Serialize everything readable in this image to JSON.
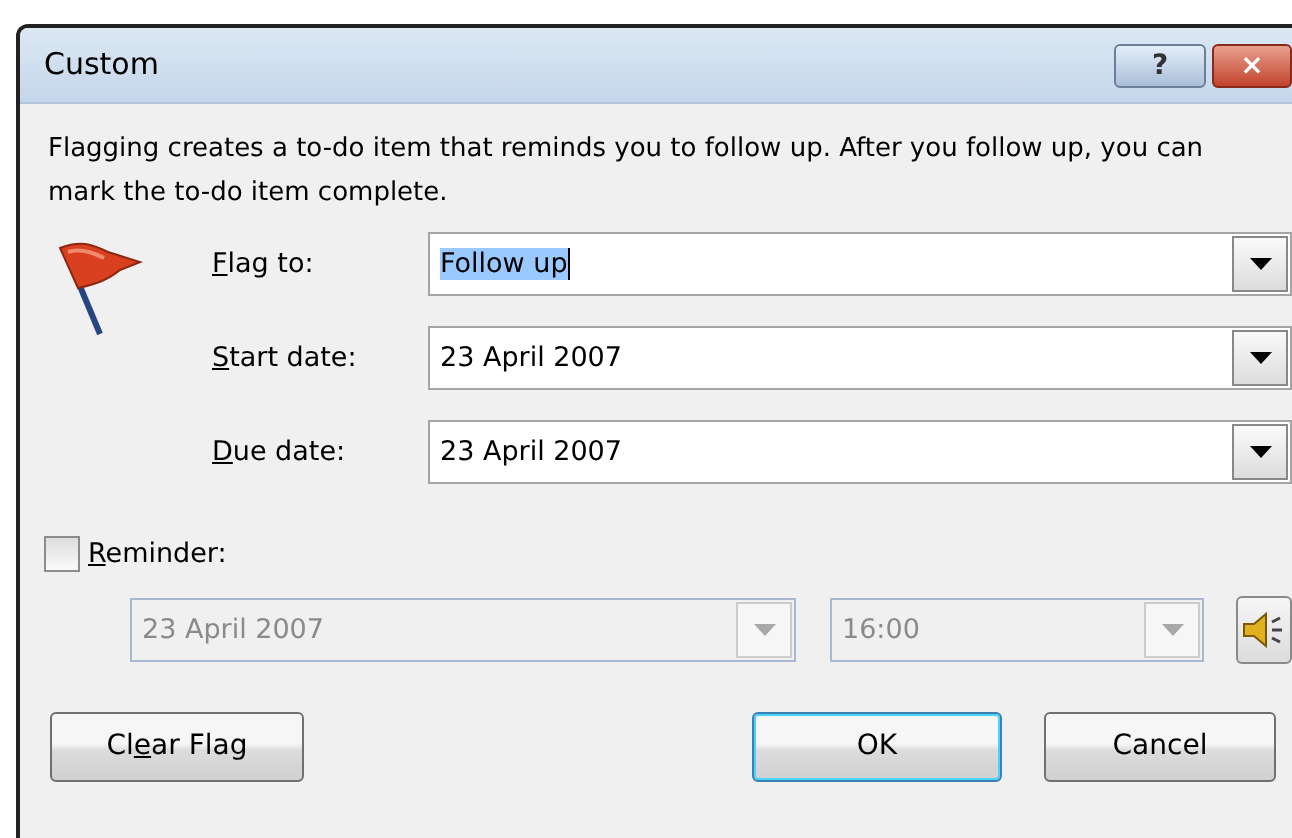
{
  "window": {
    "title": "Custom",
    "title_buttons": [
      "?",
      "×"
    ]
  },
  "description": "Flagging creates a to-do item that reminds you to follow up. After you follow up, you can mark the to-do item complete.",
  "fields": [
    {
      "label": {
        "key": "F",
        "after": "lag to:"
      },
      "value": "Follow up",
      "text_selected": true
    },
    {
      "label": {
        "key": "S",
        "after": "tart date:"
      },
      "value": "23 April 2007",
      "text_selected": false
    },
    {
      "label": {
        "key": "D",
        "after": "ue date:"
      },
      "value": "23 April 2007",
      "text_selected": false
    }
  ],
  "reminder": {
    "label": {
      "key": "R",
      "after": "eminder:"
    },
    "checked": false,
    "date": "23 April 2007",
    "time": "16:00",
    "disabled": true
  },
  "buttons": [
    {
      "label": {
        "before": "Cl",
        "key": "e",
        "after": "ar Flag"
      },
      "kind": "clear",
      "default": false
    },
    {
      "label": {
        "before": "OK"
      },
      "kind": "ok",
      "default": true
    },
    {
      "label": {
        "before": "Cancel"
      },
      "kind": "cancel",
      "default": false
    }
  ]
}
